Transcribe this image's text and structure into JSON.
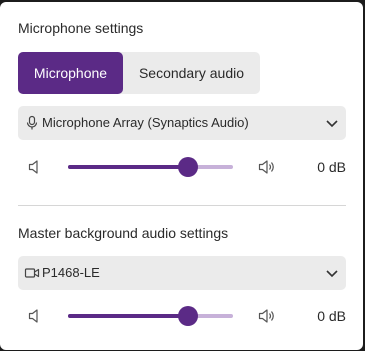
{
  "mic_section": {
    "title": "Microphone settings",
    "tabs": [
      {
        "label": "Microphone",
        "active": true
      },
      {
        "label": "Secondary audio",
        "active": false
      }
    ],
    "device": {
      "label": "Microphone Array (Synaptics Audio)",
      "icon": "microphone-icon"
    },
    "volume": {
      "level_fraction": 0.73,
      "value": "0 dB"
    }
  },
  "bg_section": {
    "title": "Master background audio settings",
    "device": {
      "label": "P1468-LE",
      "icon": "video-camera-icon"
    },
    "volume": {
      "level_fraction": 0.73,
      "value": "0 dB"
    }
  },
  "colors": {
    "accent": "#5b2a86",
    "track": "#c7b1d9",
    "surface": "#ebebeb"
  }
}
